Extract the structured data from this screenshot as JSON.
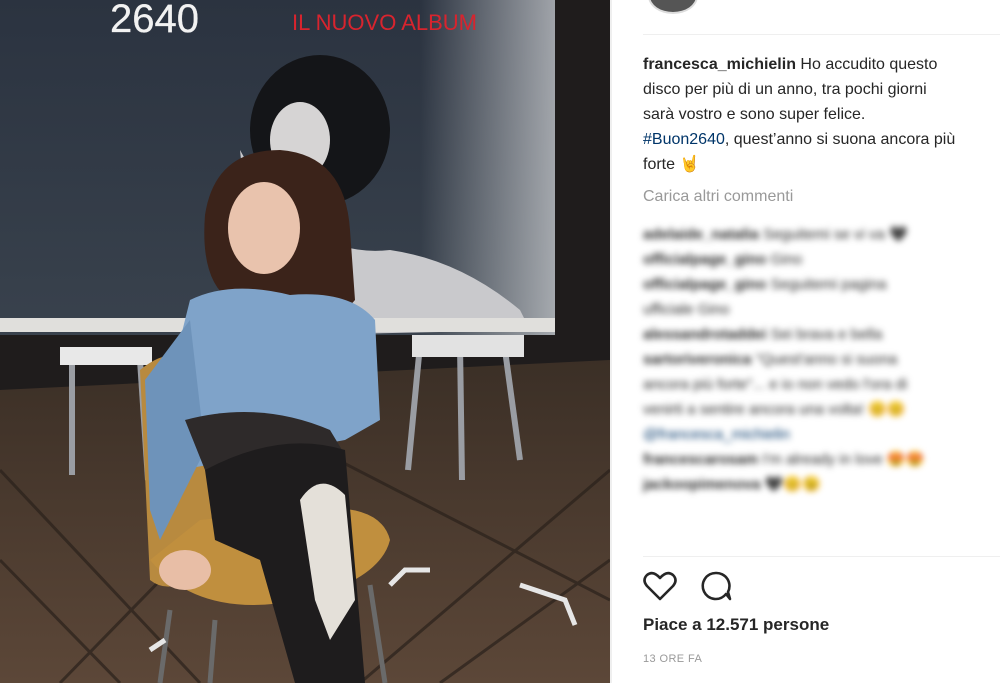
{
  "photo": {
    "banner_number": "2640",
    "banner_tagline": "IL NUOVO ALBUM"
  },
  "post": {
    "username": "francesca_michielin",
    "caption_line1": "Ho accudito questo",
    "caption_line2": "disco per più di un anno, tra pochi giorni",
    "caption_line3": "sarà vostro e sono super felice.",
    "caption_hashtag": "#Buon2640",
    "caption_line4_rest": ", quest’anno si suona ancora più",
    "caption_line5": "forte 🤘",
    "load_more_label": "Carica altri commenti",
    "likes": "Piace a 12.571 persone",
    "time_ago": "13 ORE FA"
  },
  "comments": [
    {
      "user": "adelaide_natalia",
      "text": "Seguitemi se vi va 🖤"
    },
    {
      "user": "officialpage_gino",
      "text": "Gino"
    },
    {
      "user": "officialpage_gino",
      "text": "Seguitemi pagina"
    },
    {
      "user": "",
      "text": "ufficiale Gino"
    },
    {
      "user": "alessandrotaddei",
      "text": "Sei brava e bella"
    },
    {
      "user": "sartoriveronica",
      "text": "\"Quest'anno si suona"
    },
    {
      "user": "",
      "text": "ancora più forte\"... e io non vedo l'ora di"
    },
    {
      "user": "",
      "text": "venirti a sentire ancora una volta! 😊😊"
    },
    {
      "user": "",
      "text": "@francesca_michielin"
    },
    {
      "user": "francescarosam",
      "text": "I'm already in love 😍😍"
    },
    {
      "user": "jackoopimenova",
      "text": "🖤😊😉"
    }
  ],
  "icons": {
    "like": "heart-icon",
    "comment": "comment-bubble-icon"
  },
  "colors": {
    "link": "#003569",
    "muted": "#999999",
    "text": "#262626",
    "banner_red": "#d8242e"
  }
}
